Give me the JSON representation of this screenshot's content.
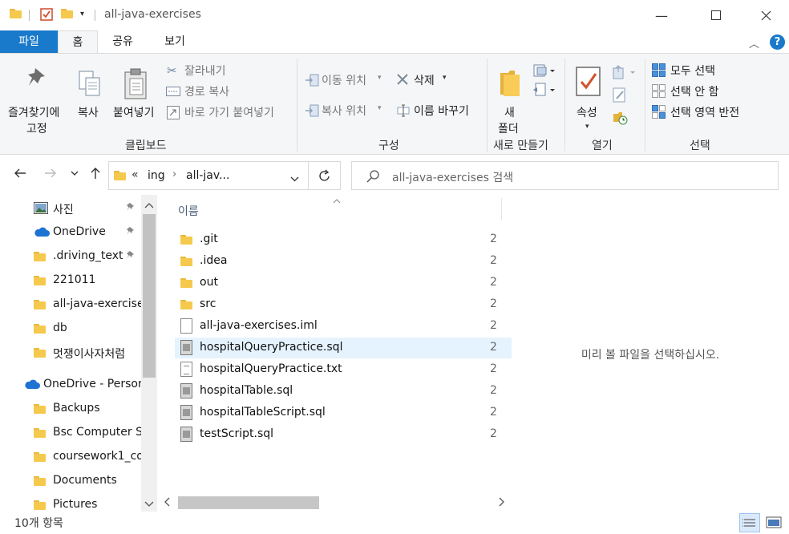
{
  "window": {
    "title": "all-java-exercises"
  },
  "ribbon_tabs": [
    "파일",
    "홈",
    "공유",
    "보기"
  ],
  "ribbon": {
    "clipboard": {
      "pin_label_1": "즐겨찾기에",
      "pin_label_2": "고정",
      "copy": "복사",
      "paste": "붙여넣기",
      "cut": "잘라내기",
      "copy_path": "경로 복사",
      "paste_shortcut": "바로 가기 붙여넣기",
      "group": "클립보드"
    },
    "organize": {
      "move_to": "이동 위치",
      "copy_to": "복사 위치",
      "delete": "삭제",
      "rename": "이름 바꾸기",
      "group": "구성"
    },
    "new": {
      "new_folder_1": "새",
      "new_folder_2": "폴더",
      "group": "새로 만들기"
    },
    "open": {
      "properties": "속성",
      "group": "열기"
    },
    "select": {
      "select_all": "모두 선택",
      "select_none": "선택 안 함",
      "invert": "선택 영역 반전",
      "group": "선택"
    }
  },
  "address": {
    "crumb_overflow": "«",
    "crumb_1": "ing",
    "crumb_2": "all-jav...",
    "search_placeholder": "all-java-exercises 검색"
  },
  "nav": [
    {
      "label": "사진",
      "icon": "picture-icon",
      "pinned": true
    },
    {
      "label": "OneDrive",
      "icon": "cloud-icon",
      "pinned": true
    },
    {
      "label": ".driving_text",
      "icon": "folder-icon",
      "pinned": true
    },
    {
      "label": "221011",
      "icon": "folder-icon",
      "pinned": false
    },
    {
      "label": "all-java-exercise",
      "icon": "folder-icon",
      "pinned": false
    },
    {
      "label": "db",
      "icon": "folder-icon",
      "pinned": false
    },
    {
      "label": "멋쟁이사자처럼",
      "icon": "folder-icon",
      "pinned": false
    },
    {
      "label": "OneDrive - Persor",
      "icon": "cloud-icon",
      "pinned": false
    },
    {
      "label": "Backups",
      "icon": "folder-icon",
      "pinned": false
    },
    {
      "label": "Bsc Computer S",
      "icon": "folder-icon",
      "pinned": false
    },
    {
      "label": "coursework1_co",
      "icon": "folder-icon",
      "pinned": false
    },
    {
      "label": "Documents",
      "icon": "folder-icon",
      "pinned": false
    },
    {
      "label": "Pictures",
      "icon": "folder-icon",
      "pinned": false
    }
  ],
  "files": {
    "column_name": "이름",
    "date_fragment": "2",
    "items": [
      {
        "name": ".git",
        "type": "folder"
      },
      {
        "name": ".idea",
        "type": "folder"
      },
      {
        "name": "out",
        "type": "folder"
      },
      {
        "name": "src",
        "type": "folder"
      },
      {
        "name": "all-java-exercises.iml",
        "type": "file"
      },
      {
        "name": "hospitalQueryPractice.sql",
        "type": "sql",
        "selected": true
      },
      {
        "name": "hospitalQueryPractice.txt",
        "type": "txt"
      },
      {
        "name": "hospitalTable.sql",
        "type": "sql"
      },
      {
        "name": "hospitalTableScript.sql",
        "type": "sql"
      },
      {
        "name": "testScript.sql",
        "type": "sql"
      }
    ]
  },
  "preview": {
    "message": "미리 볼 파일을 선택하십시오."
  },
  "status": {
    "item_count": "10개 항목"
  },
  "colors": {
    "file_tab": "#1979ca",
    "selection": "#e5f3ff",
    "folder": "#f5c94d",
    "help": "#1979ca"
  }
}
